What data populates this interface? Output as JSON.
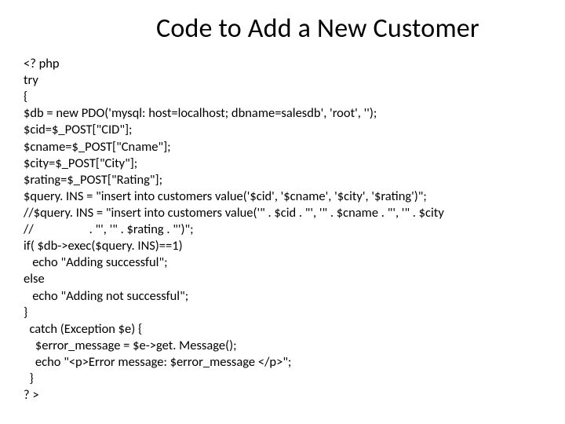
{
  "title": "Code to Add a New Customer",
  "code_lines": [
    "<? php",
    "try",
    "{",
    "$db = new PDO('mysql: host=localhost; dbname=salesdb', 'root', '');",
    "$cid=$_POST[\"CID\"];",
    "$cname=$_POST[\"Cname\"];",
    "$city=$_POST[\"City\"];",
    "$rating=$_POST[\"Rating\"];",
    "$query. INS = \"insert into customers value('$cid', '$cname', '$city', '$rating')\";",
    "//$query. INS = \"insert into customers value('\" . $cid . \"', '\" . $cname . \"', '\" . $city",
    "//                   . \"', '\" . $rating . \"')\";",
    "if( $db->exec($query. INS)==1)",
    "   echo \"Adding successful\";",
    "else",
    "   echo \"Adding not successful\";",
    "}",
    "  catch (Exception $e) {",
    "    $error_message = $e->get. Message();",
    "    echo \"<p>Error message: $error_message </p>\";",
    "  }",
    "? >"
  ]
}
